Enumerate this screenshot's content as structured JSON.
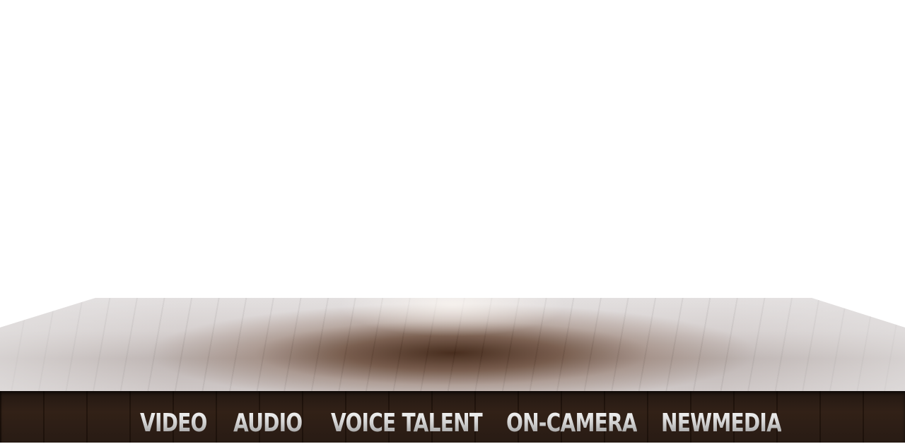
{
  "nav": {
    "items": [
      {
        "label": "VIDEO"
      },
      {
        "label": "AUDIO"
      },
      {
        "label": "VOICE TALENT"
      },
      {
        "label": "ON-CAMERA"
      },
      {
        "label": "NEWMEDIA"
      }
    ]
  },
  "colors": {
    "background": "#ffffff",
    "wood_dark": "#2b1a10",
    "wood_surface": "#5c3a26",
    "nav_text": "#c8c8c8"
  }
}
